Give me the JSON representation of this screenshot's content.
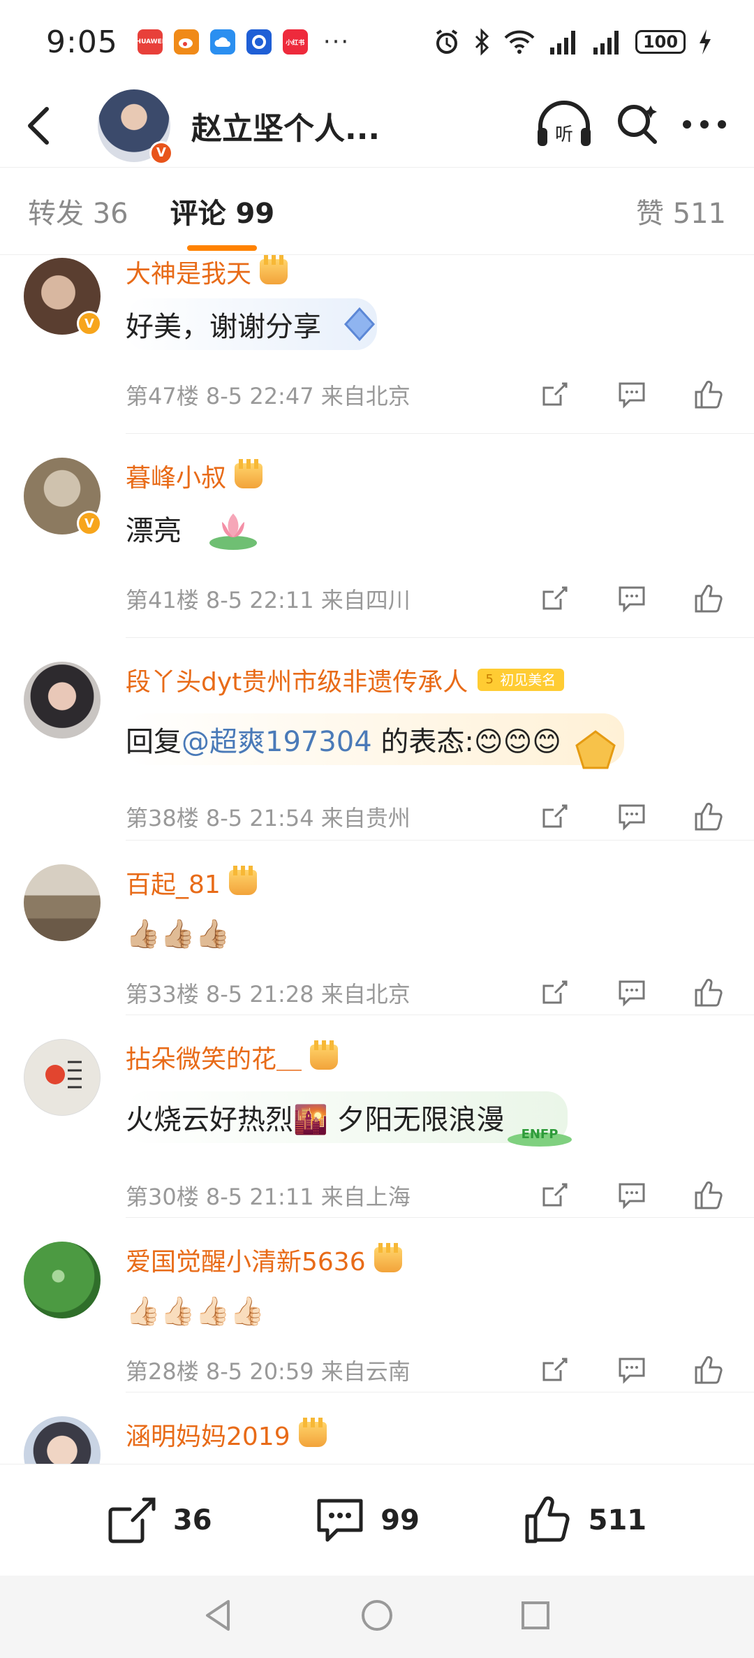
{
  "status": {
    "time": "9:05",
    "apps": [
      {
        "name": "huawei-app-icon",
        "label": "HUAWEI",
        "color": "#e8403a"
      },
      {
        "name": "weibo-app-icon",
        "label": "",
        "color": "#f08a18"
      },
      {
        "name": "cloud-app-icon",
        "label": "",
        "color": "#2b8ff0"
      },
      {
        "name": "browser-app-icon",
        "label": "",
        "color": "#1f5fd6"
      },
      {
        "name": "xiaohongshu-app-icon",
        "label": "小红书",
        "color": "#ee2a3c"
      }
    ],
    "more": "···",
    "battery": "100"
  },
  "header": {
    "title": "赵立坚个人..."
  },
  "tabs": {
    "repost": "转发 36",
    "comment": "评论 99",
    "like": "赞 511"
  },
  "comments": [
    {
      "username": "大神是我天",
      "content": "好美，谢谢分享",
      "meta": "第47楼 8-5 22:47 来自北京",
      "avatar_color": "#6b4a3a",
      "verified": true,
      "bubble": "#e8f0fb"
    },
    {
      "username": "暮峰小叔",
      "content": "漂亮",
      "meta": "第41楼 8-5 22:11 来自四川",
      "avatar_color": "#8c7a60",
      "verified": true,
      "bubble": "#ffffff"
    },
    {
      "username": "段丫头dyt贵州市级非遗传承人",
      "tag": "初见美名",
      "content_prefix": "回复",
      "mention": "@超爽197304",
      "content_suffix": " 的表态:😊😊😊",
      "meta": "第38楼 8-5 21:54 来自贵州",
      "avatar_color": "#5c4a48",
      "verified": false,
      "bubble": "#fff6e3"
    },
    {
      "username": "百起_81",
      "content": "👍🏼👍🏼👍🏼",
      "meta": "第33楼 8-5 21:28 来自北京",
      "avatar_color": "#7a6a58",
      "verified": false,
      "bubble": "#ffffff"
    },
    {
      "username": "拈朵微笑的花＿",
      "content": "火烧云好热烈🌇 夕阳无限浪漫",
      "meta": "第30楼 8-5 21:11 来自上海",
      "avatar_color": "#e9e6df",
      "verified": false,
      "bubble": "#eef7ec"
    },
    {
      "username": "爱国觉醒小清新5636",
      "content": "👍🏻👍🏻👍🏻👍🏻",
      "meta": "第28楼 8-5 20:59 来自云南",
      "avatar_color": "#3f8a3a",
      "verified": false,
      "bubble": "#ffffff"
    },
    {
      "username": "涵明妈妈2019",
      "content": "",
      "meta": "",
      "avatar_color": "#c9d4e4",
      "verified": false,
      "bubble": "#ffffff"
    }
  ],
  "bottom": {
    "repost_count": "36",
    "comment_count": "99",
    "like_count": "511"
  },
  "colors": {
    "accent": "#ff8200",
    "username": "#e86b18",
    "meta": "#999999",
    "mention": "#4a7ab8"
  }
}
